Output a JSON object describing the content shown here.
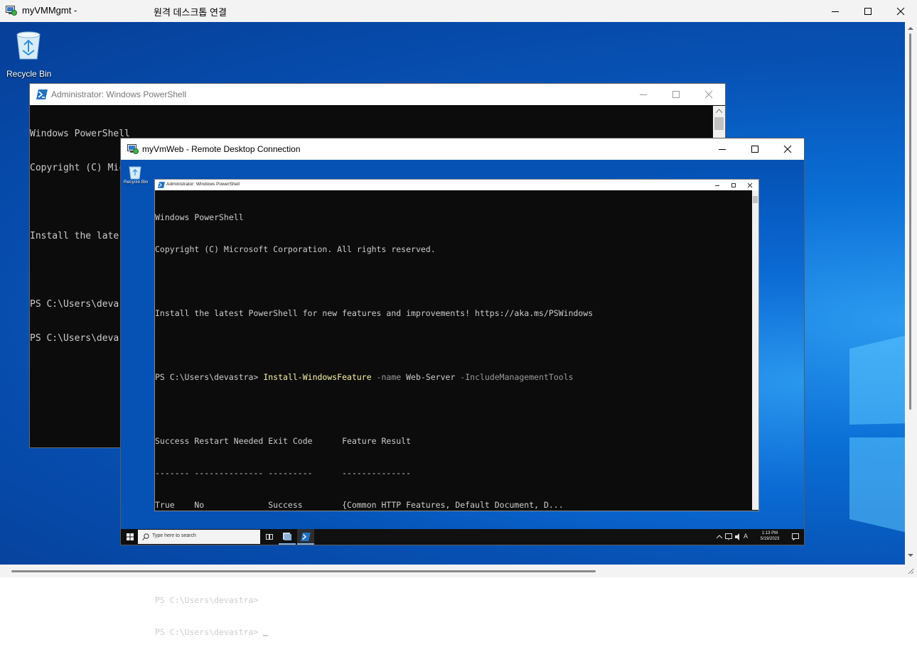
{
  "outer": {
    "title": "myVMMgmt -",
    "title_suffix": "원격 데스크톱 연결",
    "recycle_bin_label": "Recycle Bin"
  },
  "ps1": {
    "title": "Administrator: Windows PowerShell",
    "lines": [
      "Windows PowerShell",
      "Copyright (C) Microsoft Corporation. All rights reserved.",
      "",
      "Install the late",
      "",
      "PS C:\\Users\\deva",
      "PS C:\\Users\\deva"
    ]
  },
  "rdp": {
    "title": "myVmWeb - Remote Desktop Connection",
    "recycle_bin_label": "Recycle Bin"
  },
  "ps2": {
    "title": "Administrator: Windows PowerShell",
    "line1": "Windows PowerShell",
    "line2": "Copyright (C) Microsoft Corporation. All rights reserved.",
    "line3": "Install the latest PowerShell for new features and improvements! https://aka.ms/PSWindows",
    "prompt": "PS C:\\Users\\devastra> ",
    "cmd": "Install-WindowsFeature",
    "param1": " -name",
    "arg1": " Web-Server",
    "param2": " -IncludeManagementTools",
    "table_header": "Success Restart Needed Exit Code      Feature Result",
    "table_sep": "------- -------------- ---------      --------------",
    "table_row": "True    No             Success        {Common HTTP Features, Default Document, D...",
    "prompt2": "PS C:\\Users\\devastra>",
    "prompt3": "PS C:\\Users\\devastra>"
  },
  "taskbar": {
    "search_placeholder": "Type here to search",
    "time": "1:13 PM",
    "date": "5/19/2023",
    "ime": "A"
  },
  "colors": {
    "cmd_yellow": "#f9f1a5",
    "param_gray": "#9a9a9a",
    "ps_blue": "#2372c1"
  }
}
